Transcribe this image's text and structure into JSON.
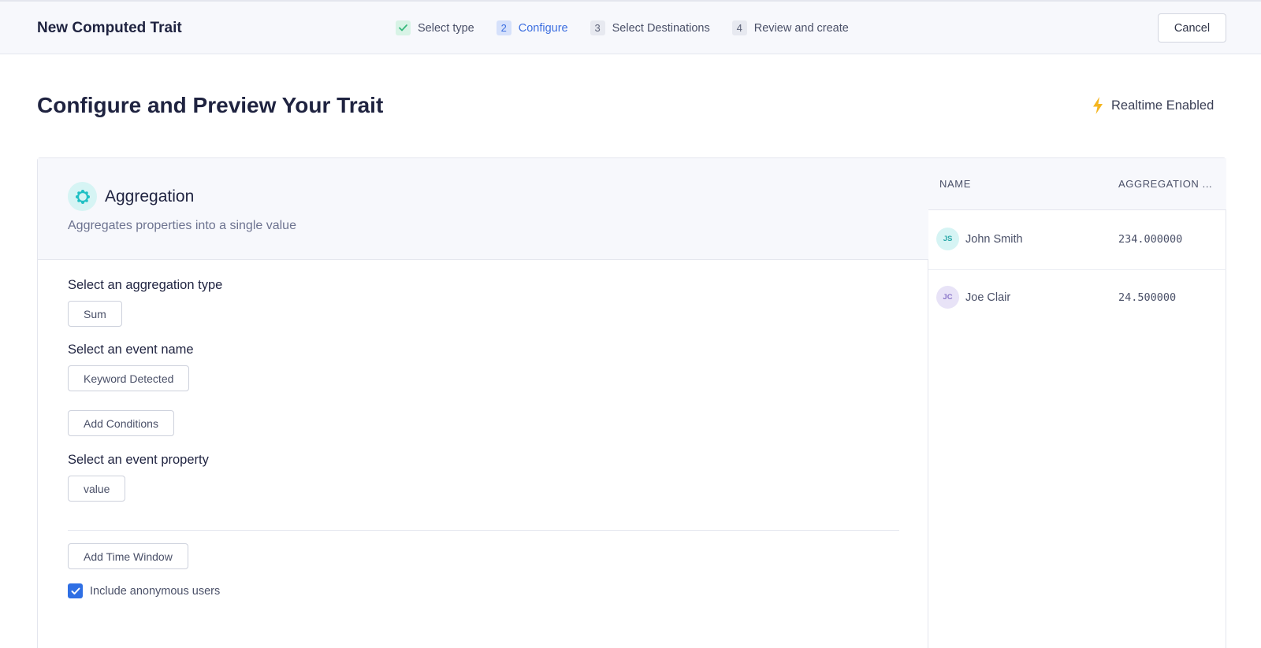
{
  "header": {
    "title": "New Computed Trait",
    "cancel_label": "Cancel"
  },
  "steps": [
    {
      "num": "",
      "label": "Select type",
      "state": "done"
    },
    {
      "num": "2",
      "label": "Configure",
      "state": "active"
    },
    {
      "num": "3",
      "label": "Select Destinations",
      "state": "pending"
    },
    {
      "num": "4",
      "label": "Review and create",
      "state": "pending"
    }
  ],
  "page": {
    "title": "Configure and Preview Your Trait",
    "realtime_label": "Realtime Enabled"
  },
  "config": {
    "type_title": "Aggregation",
    "type_description": "Aggregates properties into a single value",
    "aggregation_label": "Select an aggregation type",
    "aggregation_value": "Sum",
    "event_label": "Select an event name",
    "event_value": "Keyword Detected",
    "add_conditions_label": "Add Conditions",
    "property_label": "Select an event property",
    "property_value": "value",
    "add_time_window_label": "Add Time Window",
    "include_anonymous_label": "Include anonymous users",
    "include_anonymous_checked": true
  },
  "preview": {
    "columns": [
      "NAME",
      "AGGREGATION ..."
    ],
    "rows": [
      {
        "initials": "JS",
        "name": "John Smith",
        "value": "234.000000",
        "avatar_bg": "#d6f4f4",
        "avatar_fg": "#2aa8a8"
      },
      {
        "initials": "JC",
        "name": "Joe Clair",
        "value": "24.500000",
        "avatar_bg": "#e8e3f7",
        "avatar_fg": "#8a76c9"
      }
    ]
  },
  "colors": {
    "accent": "#3d6fe0",
    "success": "#37b97d",
    "bolt": "#f4b51f",
    "aggregation_icon": "#21c0c4"
  },
  "icons": {
    "step_done": "check-icon",
    "realtime": "lightning-icon",
    "aggregation": "aggregation-icon",
    "checkbox": "checkmark-icon"
  }
}
